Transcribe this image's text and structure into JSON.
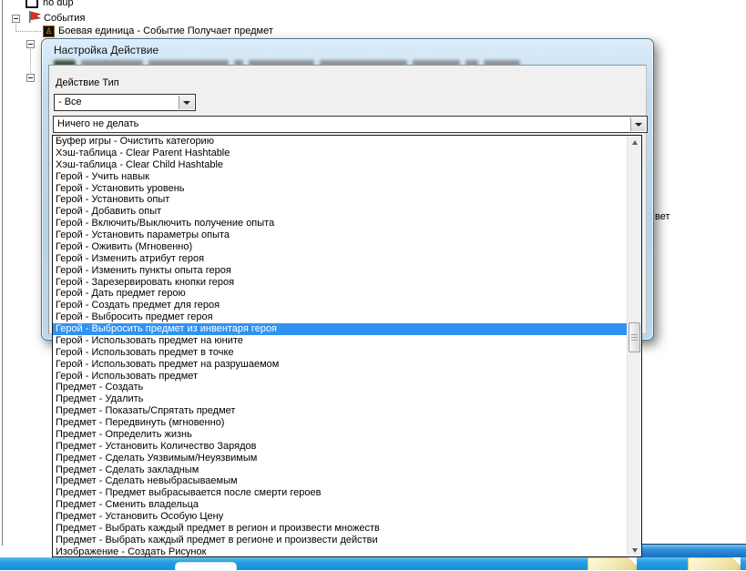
{
  "colors": {
    "selection_blue": "#3093f2",
    "dialog_frame_blue": "#b5d3e9",
    "window_edge_blue": "#1b8fd8",
    "flag_red": "#e0301e",
    "unit_icon_gold": "#e3ae28"
  },
  "tree": {
    "items": [
      {
        "label": "no dup",
        "icon": "page-icon"
      },
      {
        "label": "События",
        "icon": "flag-icon"
      },
      {
        "label": "Боевая единица - Событие Получает предмет",
        "icon": "unit-event-icon"
      }
    ]
  },
  "background": {
    "clipped_text_fragment": "вет"
  },
  "dialog": {
    "title": "Настройка Действие",
    "field_label": "Действие Тип",
    "type_combobox_value": "- Все",
    "action_combobox_value": "Ничего не делать"
  },
  "dropdown": {
    "selected_index": 16,
    "items": [
      "Буфер игры - Очистить категорию",
      "Хэш-таблица - Clear Parent Hashtable",
      "Хэш-таблица - Clear Child Hashtable",
      "Герой - Учить навык",
      "Герой - Установить уровень",
      "Герой - Установить опыт",
      "Герой - Добавить опыт",
      "Герой - Включить/Выключить получение опыта",
      "Герой - Установить параметры опыта",
      "Герой - Оживить (Мгновенно)",
      "Герой - Изменить атрибут героя",
      "Герой - Изменить пункты опыта героя",
      "Герой - Зарезервировать кнопки героя",
      "Герой - Дать предмет герою",
      "Герой - Создать предмет для героя",
      "Герой - Выбросить предмет героя",
      "Герой - Выбросить предмет из инвентаря героя",
      "Герой - Использовать предмет на юните",
      "Герой - Использовать предмет в точке",
      "Герой - Использовать предмет на разрушаемом",
      "Герой - Использовать предмет",
      "Предмет - Создать",
      "Предмет - Удалить",
      "Предмет - Показать/Спрятать предмет",
      "Предмет - Передвинуть (мгновенно)",
      "Предмет - Определить жизнь",
      "Предмет - Установить Количество Зарядов",
      "Предмет - Сделать Уязвимым/Неуязвимым",
      "Предмет - Сделать закладным",
      "Предмет - Сделать невыбрасываемым",
      "Предмет - Предмет выбрасывается после смерти героев",
      "Предмет - Сменить владельца",
      "Предмет - Установить Особую Цену",
      "Предмет - Выбрать каждый предмет в регион и произвести множеств",
      "Предмет - Выбрать каждый предмет в регионе и произвести действи",
      "Изображение - Создать Рисунок"
    ]
  }
}
